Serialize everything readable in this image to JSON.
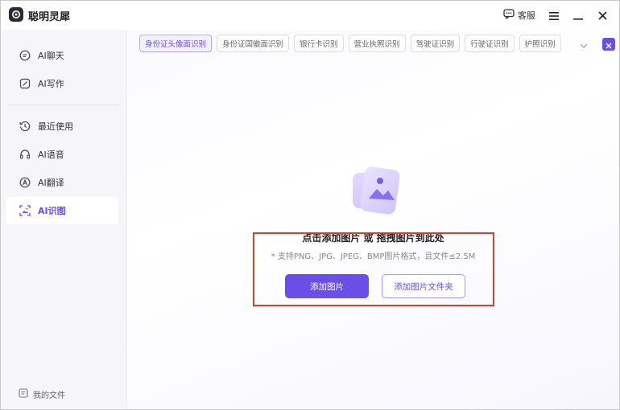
{
  "app": {
    "title": "聪明灵犀"
  },
  "titlebar": {
    "customer_service": "客服"
  },
  "sidebar": {
    "items": [
      {
        "label": "AI聊天",
        "icon": "chat-icon"
      },
      {
        "label": "AI写作",
        "icon": "write-icon"
      },
      {
        "label": "最近使用",
        "icon": "history-icon"
      },
      {
        "label": "AI语音",
        "icon": "voice-icon"
      },
      {
        "label": "AI翻译",
        "icon": "translate-icon"
      },
      {
        "label": "AI识图",
        "icon": "scan-image-icon",
        "active": true
      }
    ],
    "my_files": "我的文件"
  },
  "tabs": [
    {
      "label": "身份证头像面识别",
      "active": true
    },
    {
      "label": "身份证国徽面识别"
    },
    {
      "label": "银行卡识别"
    },
    {
      "label": "营业执照识别"
    },
    {
      "label": "驾驶证识别"
    },
    {
      "label": "行驶证识别"
    },
    {
      "label": "护照识别"
    }
  ],
  "upload": {
    "title": "点击添加图片 或 拖拽图片到此处",
    "hint": "* 支持PNG、JPG、JPEG、BMP图片格式，且文件≤2.5M",
    "add_image": "添加图片",
    "add_folder": "添加图片文件夹"
  },
  "colors": {
    "accent": "#6a4ee8",
    "highlight": "#d0432b"
  }
}
